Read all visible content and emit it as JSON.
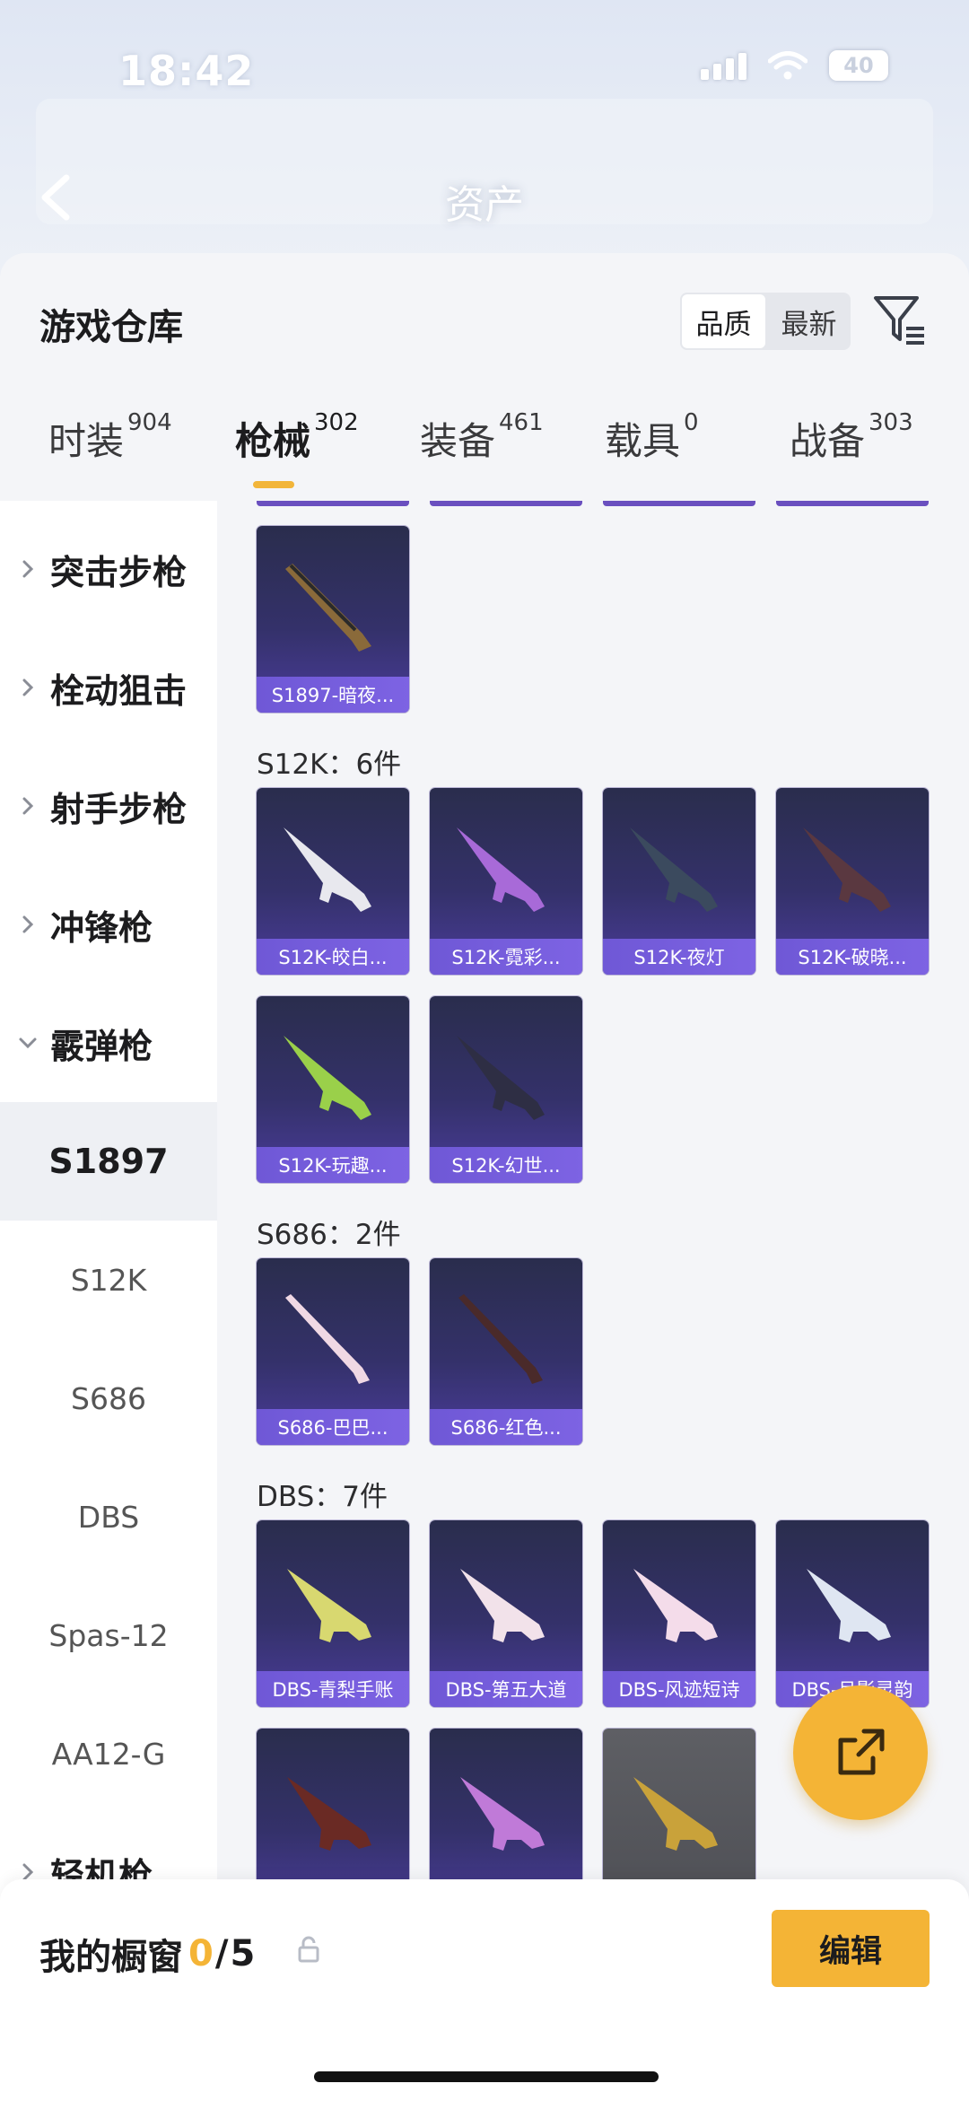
{
  "status": {
    "time": "18:42",
    "battery": "40"
  },
  "header": {
    "title": "资产"
  },
  "sheet": {
    "title": "游戏仓库",
    "sort": {
      "options": [
        "品质",
        "最新"
      ],
      "selected": "品质"
    }
  },
  "tabs": [
    {
      "label": "时装",
      "count": "904"
    },
    {
      "label": "枪械",
      "count": "302",
      "active": true
    },
    {
      "label": "装备",
      "count": "461"
    },
    {
      "label": "载具",
      "count": "0"
    },
    {
      "label": "战备",
      "count": "303"
    }
  ],
  "sidebar": {
    "categories": [
      "突击步枪",
      "栓动狙击",
      "射手步枪",
      "冲锋枪",
      "霰弹枪"
    ],
    "sub_items": [
      "S1897",
      "S12K",
      "S686",
      "DBS",
      "Spas-12",
      "AA12-G"
    ],
    "active_sub": "S1897",
    "last_category": "轻机枪"
  },
  "groups": [
    {
      "title": "",
      "items": [
        "S1897-暗夜..."
      ]
    },
    {
      "title": "S12K：6件",
      "items": [
        "S12K-皎白...",
        "S12K-霓彩...",
        "S12K-夜灯",
        "S12K-破晓...",
        "S12K-玩趣...",
        "S12K-幻世..."
      ]
    },
    {
      "title": "S686：2件",
      "items": [
        "S686-巴巴...",
        "S686-红色..."
      ]
    },
    {
      "title": "DBS：7件",
      "items": [
        "DBS-青梨手账",
        "DBS-第五大道",
        "DBS-风迹短诗",
        "DBS-月影灵韵"
      ]
    }
  ],
  "bottom": {
    "showcase_label": "我的橱窗",
    "showcase_current": "0",
    "showcase_max": "5",
    "edit_label": "编辑"
  },
  "colors": {
    "accent": "#f4b436",
    "card_caption": "#7560dc",
    "card_bg": "#2f2f5a"
  }
}
